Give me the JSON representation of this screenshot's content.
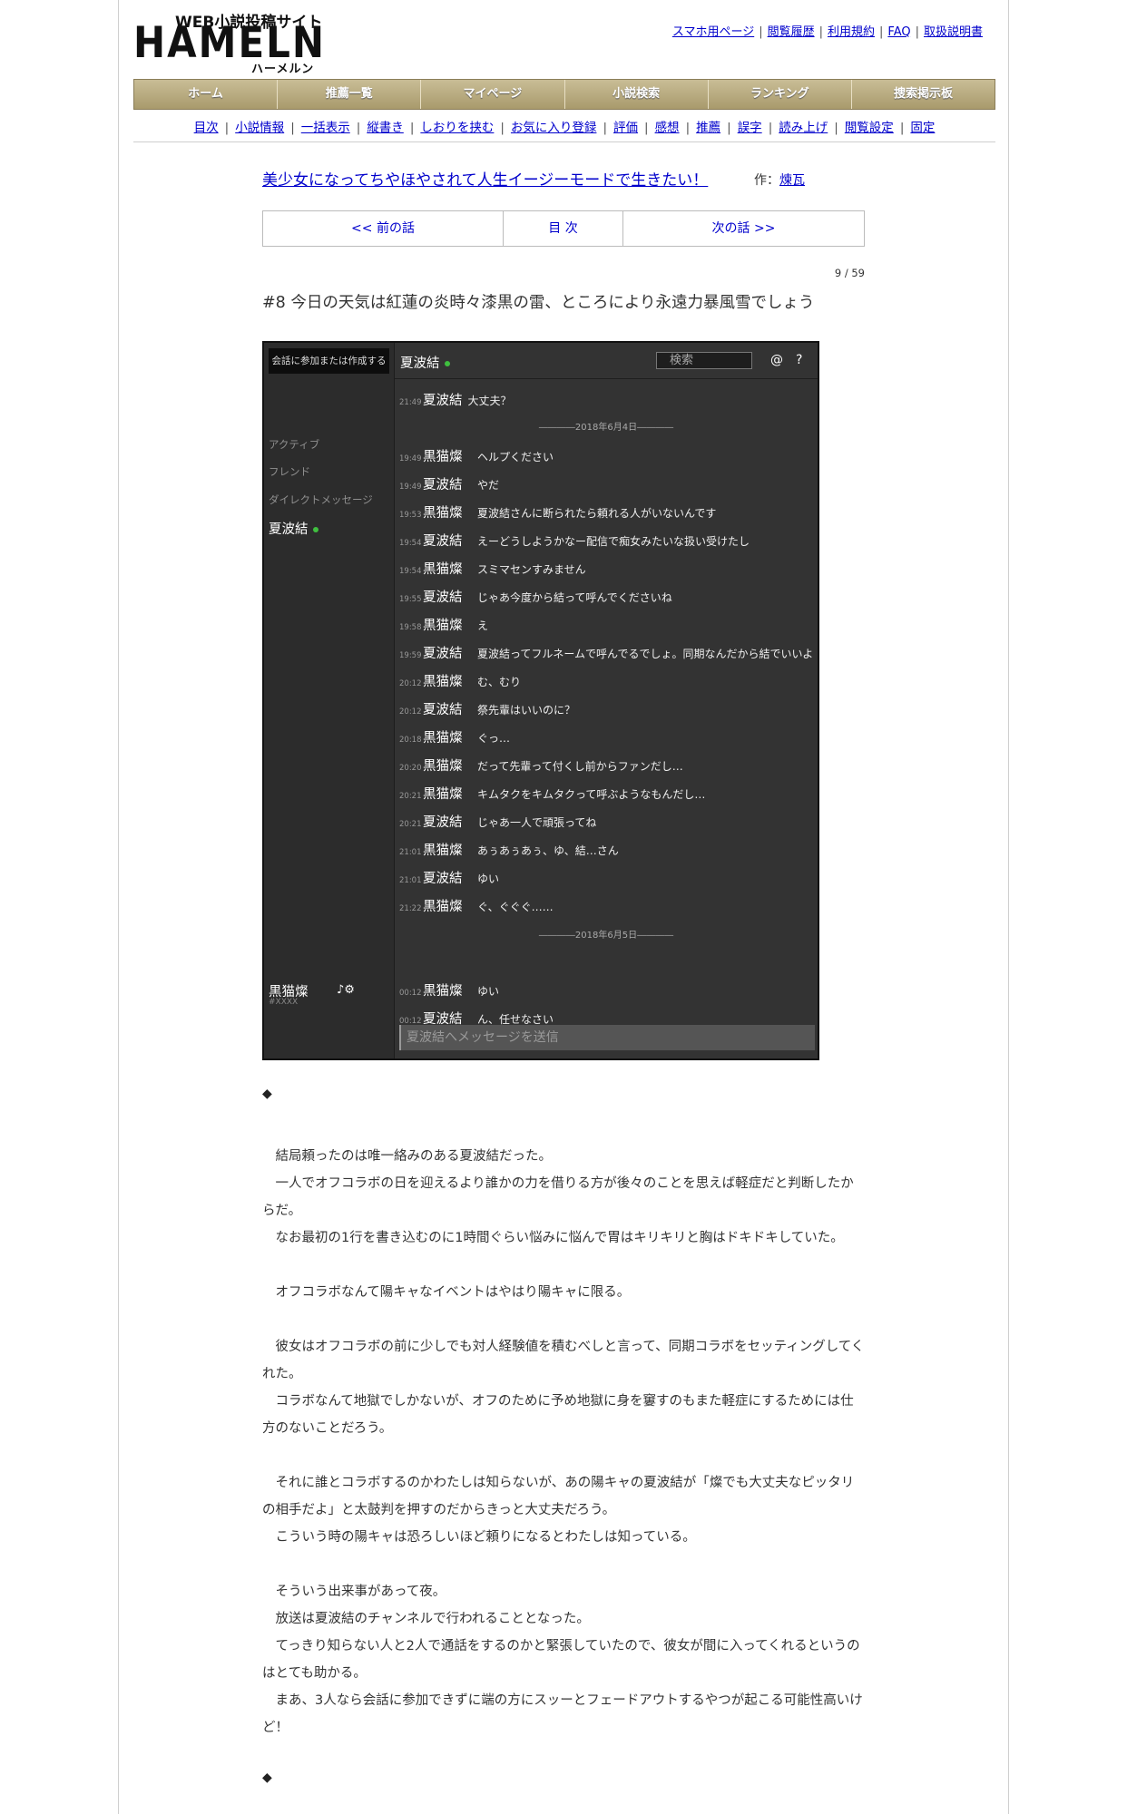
{
  "header": {
    "logo_main": "HAMELN",
    "logo_sub": "WEB小説投稿サイト",
    "logo_kana": "ハーメルン",
    "top_links": [
      "スマホ用ページ",
      "閲覧履歴",
      "利用規約",
      "FAQ",
      "取扱説明書"
    ],
    "main_nav": [
      "ホーム",
      "推薦一覧",
      "マイページ",
      "小説検索",
      "ランキング",
      "捜索掲示板"
    ],
    "sub_nav": [
      "目次",
      "小説情報",
      "一括表示",
      "縦書き",
      "しおりを挟む",
      "お気に入り登録",
      "評価",
      "感想",
      "推薦",
      "誤字",
      "読み上げ",
      "閲覧設定",
      "固定"
    ]
  },
  "novel": {
    "title": "美少女になってちやほやされて人生イージーモードで生きたい！",
    "author_label": "作：",
    "author": "煉瓦",
    "prev": "<< 前の話",
    "toc": "目 次",
    "next": "次の話 >>",
    "page_count": "9 / 59",
    "chapter_title": "#8 今日の天気は紅蓮の炎時々漆黒の雷、ところにより永遠力暴風雪でしょう"
  },
  "chat": {
    "join_button": "会話に参加または作成する",
    "side_labels": [
      "アクティブ",
      "フレンド",
      "ダイレクトメッセージ"
    ],
    "dm_name": "夏波結",
    "me_name": "黒猫燦",
    "me_tag": "#XXXX",
    "me_icons": "♪⚙",
    "channel_name": "夏波結",
    "search_placeholder": "検索",
    "at_icon": "@",
    "help_icon": "?",
    "first_message": {
      "time": "21:49",
      "name": "夏波結",
      "text": "大丈夫？"
    },
    "date1": "――――2018年6月4日――――",
    "messages1": [
      {
        "time": "19:49",
        "name": "黒猫燦",
        "text": "ヘルプください"
      },
      {
        "time": "19:49",
        "name": "夏波結",
        "text": "やだ"
      },
      {
        "time": "19:53",
        "name": "黒猫燦",
        "text": "夏波結さんに断られたら頼れる人がいないんです"
      },
      {
        "time": "19:54",
        "name": "夏波結",
        "text": "えーどうしようかなー配信で痴女みたいな扱い受けたし"
      },
      {
        "time": "19:54",
        "name": "黒猫燦",
        "text": "スミマセンすみません"
      },
      {
        "time": "19:55",
        "name": "夏波結",
        "text": "じゃあ今度から結って呼んでくださいね"
      },
      {
        "time": "19:58",
        "name": "黒猫燦",
        "text": "え"
      },
      {
        "time": "19:59",
        "name": "夏波結",
        "text": "夏波結ってフルネームで呼んでるでしょ。同期なんだから結でいいよ"
      },
      {
        "time": "20:12",
        "name": "黒猫燦",
        "text": "む、むり"
      },
      {
        "time": "20:12",
        "name": "夏波結",
        "text": "祭先輩はいいのに？"
      },
      {
        "time": "20:18",
        "name": "黒猫燦",
        "text": "ぐっ…"
      },
      {
        "time": "20:20",
        "name": "黒猫燦",
        "text": "だって先輩って付くし前からファンだし…"
      },
      {
        "time": "20:21",
        "name": "黒猫燦",
        "text": "キムタクをキムタクって呼ぶようなもんだし…"
      },
      {
        "time": "20:21",
        "name": "夏波結",
        "text": "じゃあ一人で頑張ってね"
      },
      {
        "time": "21:01",
        "name": "黒猫燦",
        "text": "あぅあぅあぅ、ゆ、結…さん"
      },
      {
        "time": "21:01",
        "name": "夏波結",
        "text": "ゆい"
      },
      {
        "time": "21:22",
        "name": "黒猫燦",
        "text": "ぐ、ぐぐぐ……"
      }
    ],
    "date2": "――――2018年6月5日――――",
    "messages2": [
      {
        "time": "00:12",
        "name": "黒猫燦",
        "text": "ゆい"
      },
      {
        "time": "00:12",
        "name": "夏波結",
        "text": "ん、任せなさい"
      }
    ],
    "input_placeholder": "夏波結へメッセージを送信"
  },
  "body": {
    "diamond": "◆",
    "block1": [
      "　結局頼ったのは唯一絡みのある夏波結だった。",
      "　一人でオフコラボの日を迎えるより誰かの力を借りる方が後々のことを思えば軽症だと判断したからだ。",
      "　なお最初の1行を書き込むのに1時間ぐらい悩みに悩んで胃はキリキリと胸はドキドキしていた。"
    ],
    "block2": [
      "　オフコラボなんて陽キャなイベントはやはり陽キャに限る。"
    ],
    "block3": [
      "　彼女はオフコラボの前に少しでも対人経験値を積むべしと言って、同期コラボをセッティングしてくれた。",
      "　コラボなんて地獄でしかないが、オフのために予め地獄に身を窶すのもまた軽症にするためには仕方のないことだろう。"
    ],
    "block4": [
      "　それに誰とコラボするのかわたしは知らないが、あの陽キャの夏波結が「燦でも大丈夫なピッタリの相手だよ」と太鼓判を押すのだからきっと大丈夫だろう。",
      "　こういう時の陽キャは恐ろしいほど頼りになるとわたしは知っている。"
    ],
    "block5": [
      "　そういう出来事があって夜。",
      "　放送は夏波結のチャンネルで行われることとなった。",
      "　てっきり知らない人と2人で通話をするのかと緊張していたので、彼女が間に入ってくれるというのはとても助かる。",
      "　まあ、3人なら会話に参加できずに端の方にスッーとフェードアウトするやつが起こる可能性高いけど！"
    ]
  }
}
